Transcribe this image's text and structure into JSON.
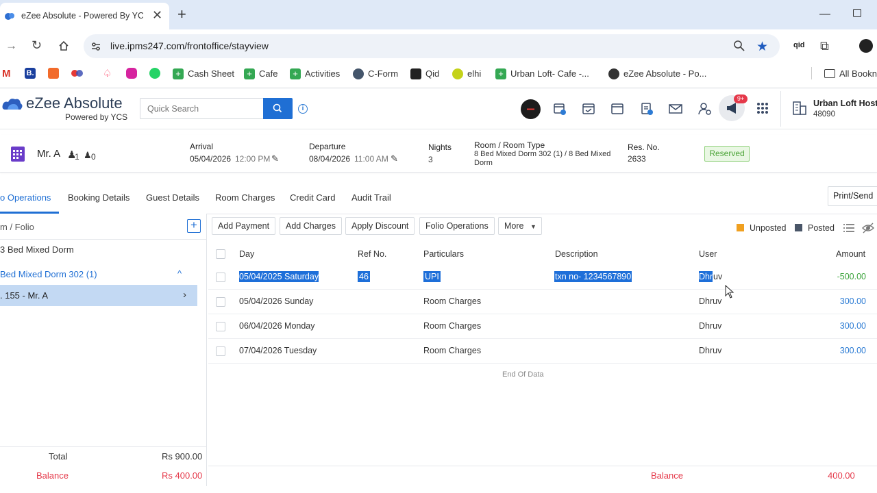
{
  "browser": {
    "tab_title": "eZee Absolute - Powered By YC",
    "new_tab": "+",
    "url": "live.ipms247.com/frontoffice/stayview",
    "profile_badge": "qid",
    "bookmarks": [
      {
        "label": "Cash Sheet",
        "color": "#34a853"
      },
      {
        "label": "Cafe",
        "color": "#34a853"
      },
      {
        "label": "Activities",
        "color": "#34a853"
      },
      {
        "label": "C-Form",
        "color": "#44556b"
      },
      {
        "label": "Qid",
        "color": "#222222"
      },
      {
        "label": "elhi",
        "color": "#c4d21a"
      },
      {
        "label": "Urban Loft- Cafe -...",
        "color": "#34a853"
      },
      {
        "label": "eZee Absolute - Po...",
        "color": "#333333"
      }
    ],
    "all_bookmarks": "All Bookn"
  },
  "app": {
    "logo_title": "eZee Absolute",
    "logo_subtitle": "Powered by YCS",
    "search_placeholder": "Quick Search",
    "notif_count": "9+",
    "property_name": "Urban Loft Hoste",
    "property_id": "48090"
  },
  "reservation": {
    "guest_name": "Mr. A",
    "adults": "1",
    "children": "0",
    "arrival_label": "Arrival",
    "arrival_date": "05/04/2026",
    "arrival_time": "12:00 PM",
    "departure_label": "Departure",
    "departure_date": "08/04/2026",
    "departure_time": "11:00 AM",
    "nights_label": "Nights",
    "nights": "3",
    "room_label": "Room / Room Type",
    "room_line1": "8 Bed Mixed Dorm 302 (1) / 8 Bed Mixed",
    "room_line2": "Dorm",
    "resno_label": "Res. No.",
    "resno": "2633",
    "status": "Reserved"
  },
  "tabs": [
    "o Operations",
    "Booking Details",
    "Guest Details",
    "Room Charges",
    "Credit Card",
    "Audit Trail"
  ],
  "print_send": "Print/Send",
  "left": {
    "header": "m / Folio",
    "room_type": "3 Bed Mixed Dorm",
    "room": "Bed Mixed Dorm 302 (1)",
    "folio": ". 155 - Mr. A",
    "total_label": "Total",
    "total_value": "Rs 900.00",
    "balance_label": "Balance",
    "balance_value": "Rs 400.00"
  },
  "actions": [
    "Add Payment",
    "Add Charges",
    "Apply Discount",
    "Folio Operations",
    "More"
  ],
  "legend": {
    "unposted": "Unposted",
    "posted": "Posted",
    "unposted_color": "#f0a020",
    "posted_color": "#4a5668"
  },
  "table": {
    "headers": [
      "Day",
      "Ref No.",
      "Particulars",
      "Description",
      "User",
      "Amount"
    ],
    "rows": [
      {
        "day": "05/04/2025 Saturday",
        "ref": "46",
        "particulars": "UPI",
        "description": "txn no- 1234567890",
        "user_sel": "Dhr",
        "user_rest": "uv",
        "amount": "-500.00"
      },
      {
        "day": "05/04/2026 Sunday",
        "ref": "",
        "particulars": "Room Charges",
        "description": "",
        "user": "Dhruv",
        "amount": "300.00"
      },
      {
        "day": "06/04/2026 Monday",
        "ref": "",
        "particulars": "Room Charges",
        "description": "",
        "user": "Dhruv",
        "amount": "300.00"
      },
      {
        "day": "07/04/2026 Tuesday",
        "ref": "",
        "particulars": "Room Charges",
        "description": "",
        "user": "Dhruv",
        "amount": "300.00"
      }
    ],
    "end_text": "End Of Data",
    "balance_label": "Balance",
    "balance_value": "400.00"
  }
}
